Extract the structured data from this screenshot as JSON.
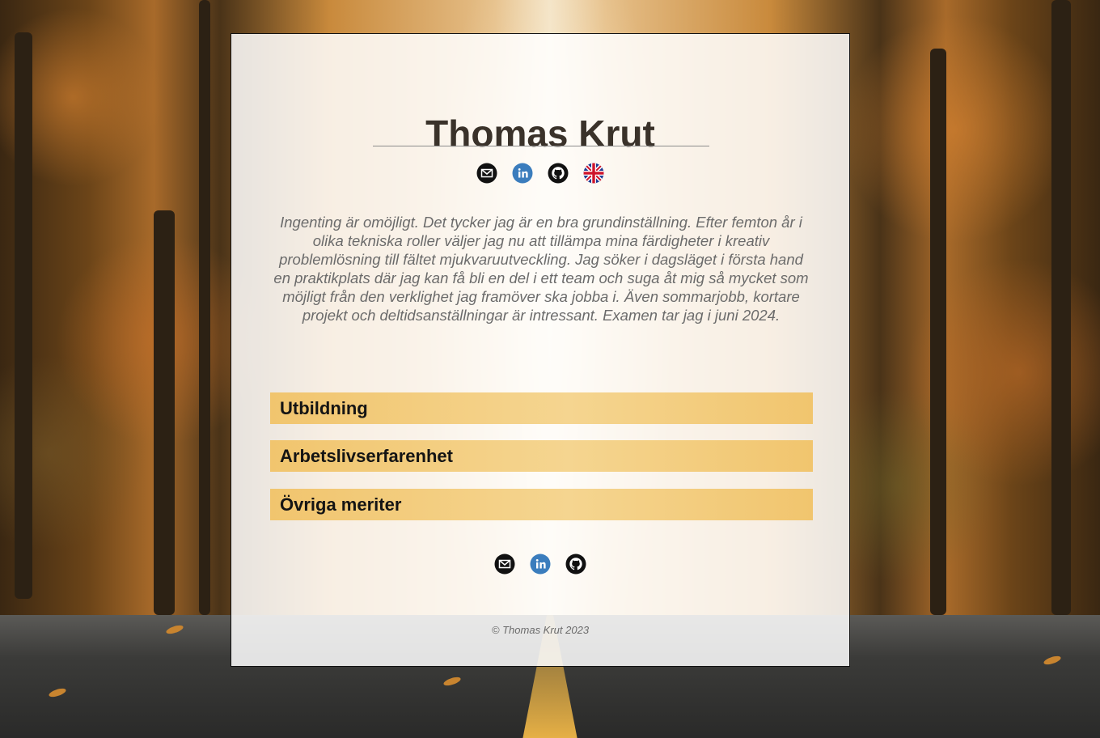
{
  "header": {
    "name": "Thomas Krut"
  },
  "social_top": [
    {
      "icon": "email-icon",
      "label": "E-post"
    },
    {
      "icon": "linkedin-icon",
      "label": "LinkedIn"
    },
    {
      "icon": "github-icon",
      "label": "GitHub"
    },
    {
      "icon": "uk-flag-icon",
      "label": "English"
    }
  ],
  "intro": "Ingenting är omöjligt. Det tycker jag är en bra grundinställning. Efter femton år i olika tekniska roller väljer jag nu att tillämpa mina färdigheter i kreativ problemlösning till fältet mjukvaruutveckling. Jag söker i dagsläget i första hand en praktikplats där jag kan få bli en del i ett team och suga åt mig så mycket som möjligt från den verklighet jag framöver ska jobba i. Även sommarjobb, kortare projekt och deltidsanställningar är intressant. Examen tar jag i juni 2024.",
  "sections": [
    {
      "label": "Utbildning"
    },
    {
      "label": "Arbetslivserfarenhet"
    },
    {
      "label": "Övriga meriter"
    }
  ],
  "social_bottom": [
    {
      "icon": "email-icon"
    },
    {
      "icon": "linkedin-icon"
    },
    {
      "icon": "github-icon"
    }
  ],
  "footer": {
    "copyright": "© Thomas Krut 2023"
  },
  "colors": {
    "section_bg": "#f3cc7e",
    "title_text": "#3a322a",
    "intro_text": "#6b6b6b",
    "linkedin_blue": "#3b7dbd"
  }
}
